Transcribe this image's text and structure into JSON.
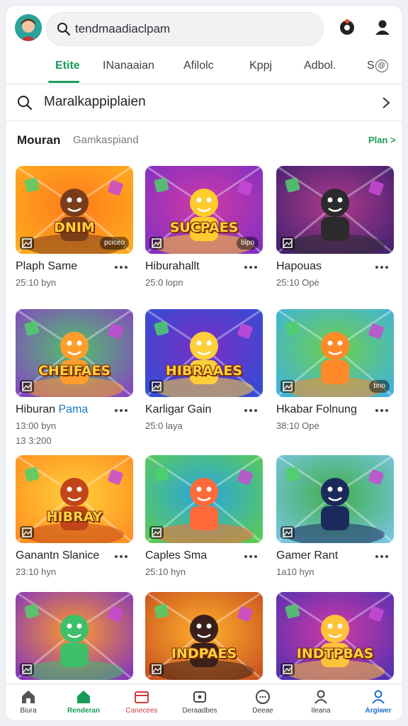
{
  "header": {
    "search_text": "tendmaadiaclpam"
  },
  "tabs": [
    {
      "label": "Etite",
      "active": true
    },
    {
      "label": "INanaaian",
      "active": false
    },
    {
      "label": "Afilolc",
      "active": false
    },
    {
      "label": "Kppj",
      "active": false
    },
    {
      "label": "Adbol.",
      "active": false
    },
    {
      "label": "S",
      "active": false,
      "badge": "@"
    }
  ],
  "result_row": {
    "text": "Maralkappiplaien"
  },
  "section": {
    "title": "Mouran",
    "subtitle": "Gamkaspiand",
    "link": "Plan >"
  },
  "games": [
    {
      "title": "Plaph Same",
      "meta": "25:10 byn",
      "tag": "pciceo",
      "art_text": "DNIM",
      "colors": [
        "#ffb020",
        "#ff7a1a",
        "#7a3d1a"
      ]
    },
    {
      "title": "Hiburahallt",
      "meta": "25:0 lopn",
      "tag": "bipo",
      "art_text": "SUCPAES",
      "colors": [
        "#7a2fc4",
        "#d13aa6",
        "#ffcc2e"
      ]
    },
    {
      "title": "Hapouas",
      "meta": "25:10 Opė",
      "tag": "",
      "art_text": "",
      "colors": [
        "#3a1f6e",
        "#b03a8c",
        "#2b2b2b"
      ]
    },
    {
      "title": "Hiburan",
      "title_hl": "Pama",
      "meta": "13:00 byn",
      "meta2": "13 3:200",
      "tag": "",
      "art_text": "CHEIFAES",
      "colors": [
        "#8a3cc8",
        "#4fc36a",
        "#ff9e2c"
      ]
    },
    {
      "title": "Karligar Gain",
      "meta": "25:0 laya",
      "tag": "",
      "art_text": "HIBRAAES",
      "colors": [
        "#2d4fd6",
        "#7a2fc4",
        "#ffcf3a"
      ]
    },
    {
      "title": "Hkabar Folnung",
      "meta": "38:10 Opė",
      "tag": "bno",
      "art_text": "",
      "colors": [
        "#3bb0e8",
        "#6fcf4a",
        "#ff8a2a"
      ]
    },
    {
      "title": "Ganantn Slanice",
      "meta": "23:10 hyn",
      "tag": "",
      "art_text": "HIBRAY",
      "colors": [
        "#ff8a1e",
        "#ffcf3a",
        "#c2451a"
      ]
    },
    {
      "title": "Caples Sma",
      "meta": "25:10 hyn",
      "tag": "",
      "art_text": "",
      "colors": [
        "#5fcf4a",
        "#2ba3e0",
        "#ff6a3a"
      ]
    },
    {
      "title": "Gamer Rant",
      "meta": "1a10 hyn",
      "tag": "",
      "art_text": "",
      "colors": [
        "#7cc7ea",
        "#3fae4a",
        "#1b2a5c"
      ]
    },
    {
      "title": "",
      "meta": "",
      "tag": "",
      "art_text": "",
      "colors": [
        "#7a2fc4",
        "#ff9a2c",
        "#3fbf6a"
      ]
    },
    {
      "title": "",
      "meta": "",
      "tag": "",
      "art_text": "INDPAES",
      "colors": [
        "#c44a1e",
        "#ffb12c",
        "#3a1f1a"
      ]
    },
    {
      "title": "",
      "meta": "",
      "tag": "",
      "art_text": "INDTPBAS",
      "colors": [
        "#4a2fb0",
        "#d13aa6",
        "#ffc23a"
      ]
    }
  ],
  "bottom_nav": [
    {
      "label": "Biura",
      "icon": "home-icon",
      "active": false
    },
    {
      "label": "Renderan",
      "icon": "home-filled-icon",
      "active": true,
      "color": "#1b9b5a"
    },
    {
      "label": "Canecees",
      "icon": "calendar-icon",
      "active": false,
      "color": "#d23a3a"
    },
    {
      "label": "Deraadbes",
      "icon": "controller-icon",
      "active": false
    },
    {
      "label": "Deeae",
      "icon": "chat-icon",
      "active": false
    },
    {
      "label": "Ileana",
      "icon": "person-icon",
      "active": false
    },
    {
      "label": "Argiwer",
      "icon": "person-blue-icon",
      "active": false,
      "color": "#1a6fd4"
    }
  ]
}
